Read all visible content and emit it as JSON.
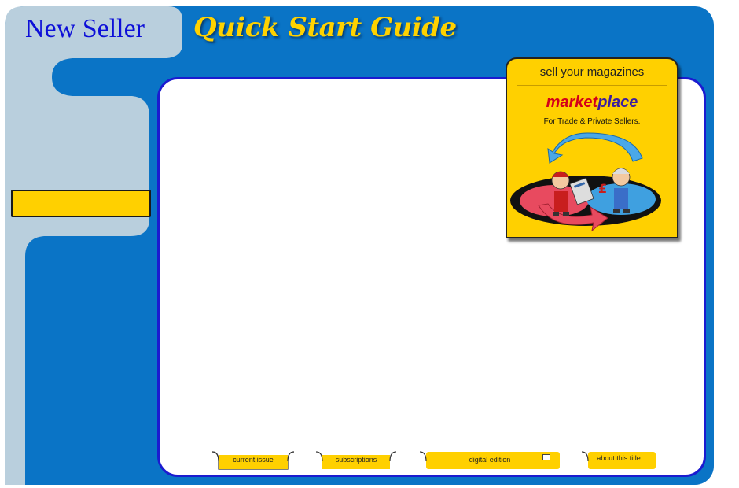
{
  "header": {
    "brand": "New Seller",
    "title": "Quick Start Guide"
  },
  "sidebar": {
    "button_label": ""
  },
  "promo": {
    "tagline": "sell your magazines",
    "brand_part1": "market",
    "brand_part2": "place",
    "subtitle": "For Trade & Private Sellers."
  },
  "tabs": [
    {
      "label": "current issue"
    },
    {
      "label": "subscriptions"
    },
    {
      "label": "digital edition",
      "icon": "monitor-icon"
    },
    {
      "label": "about this title"
    }
  ],
  "colors": {
    "frame_blue": "#0a74c6",
    "sidebar_light": "#b9cfdd",
    "accent_yellow": "#ffd000",
    "brand_blue": "#0d0fd8",
    "panel_border": "#1b1bd0"
  }
}
